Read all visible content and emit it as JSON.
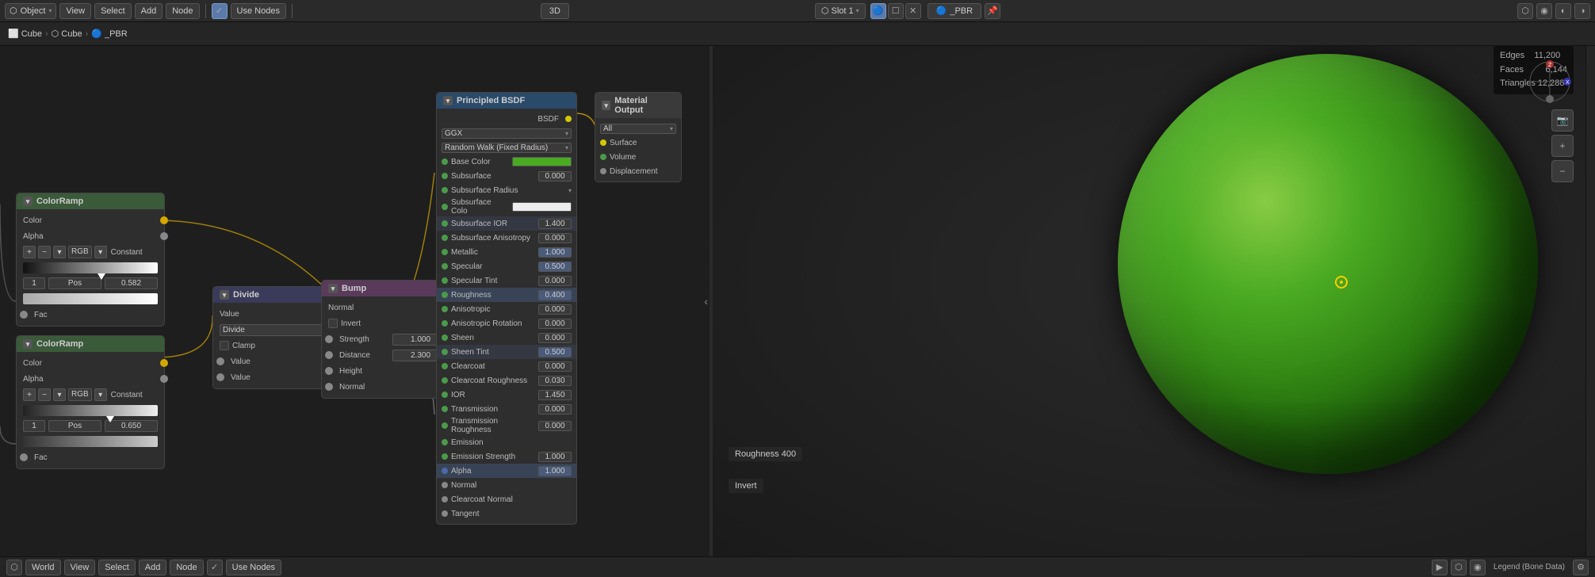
{
  "topbar": {
    "mode_label": "Object",
    "view_label": "View",
    "select_label": "Select",
    "add_label": "Add",
    "node_label": "Node",
    "use_nodes_label": "Use Nodes",
    "viewport_label": "3D",
    "slot_label": "Slot 1",
    "pbr_label": "_PBR",
    "pin_icon": "📌"
  },
  "breadcrumb": {
    "item1_icon": "⬜",
    "item1_label": "Cube",
    "item2_icon": "⬡",
    "item2_label": "Cube",
    "item3_icon": "🔵",
    "item3_label": "_PBR"
  },
  "stats": {
    "label1": "Edges",
    "value1": "11,200",
    "label2": "Faces",
    "value2": "6,144",
    "label3": "Triangles",
    "value3": "12,288"
  },
  "nodes": {
    "color_ramp_1": {
      "title": "ColorRamp",
      "color_label": "Color",
      "alpha_label": "Alpha",
      "rgb_label": "RGB",
      "constant_label": "Constant",
      "pos_num": "1",
      "pos_label": "Pos",
      "pos_value": "0.582",
      "fac_label": "Fac"
    },
    "color_ramp_2": {
      "title": "ColorRamp",
      "color_label": "Color",
      "alpha_label": "Alpha",
      "rgb_label": "RGB",
      "constant_label": "Constant",
      "pos_num": "1",
      "pos_label": "Pos",
      "pos_value": "0.650",
      "fac_label": "Fac"
    },
    "divide": {
      "title": "Divide",
      "value_label": "Value",
      "divide_label": "Divide",
      "clamp_label": "Clamp",
      "value_out1": "Value",
      "value_out2": "Value"
    },
    "bump": {
      "title": "Bump",
      "normal_label": "Normal",
      "invert_label": "Invert",
      "strength_label": "Strength",
      "strength_value": "1.000",
      "distance_label": "Distance",
      "distance_value": "2.300",
      "height_label": "Height",
      "normal_out": "Normal"
    },
    "principled": {
      "title": "Principled BSDF",
      "bsdf_label": "BSDF",
      "ggx_label": "GGX",
      "random_walk_label": "Random Walk (Fixed Radius)",
      "base_color_label": "Base Color",
      "subsurface_label": "Subsurface",
      "subsurface_value": "0.000",
      "subsurface_radius_label": "Subsurface Radius",
      "subsurface_color_label": "Subsurface Colo",
      "subsurface_ior_label": "Subsurface IOR",
      "subsurface_ior_value": "1.400",
      "subsurface_aniso_label": "Subsurface Anisotropy",
      "subsurface_aniso_value": "0.000",
      "metallic_label": "Metallic",
      "metallic_value": "1.000",
      "specular_label": "Specular",
      "specular_value": "0.500",
      "specular_tint_label": "Specular Tint",
      "specular_tint_value": "0.000",
      "roughness_label": "Roughness",
      "roughness_value": "0.400",
      "anisotropic_label": "Anisotropic",
      "anisotropic_value": "0.000",
      "aniso_rotation_label": "Anisotropic Rotation",
      "aniso_rotation_value": "0.000",
      "sheen_label": "Sheen",
      "sheen_value": "0.000",
      "sheen_tint_label": "Sheen Tint",
      "sheen_tint_value": "0.500",
      "clearcoat_label": "Clearcoat",
      "clearcoat_value": "0.000",
      "clearcoat_roughness_label": "Clearcoat Roughness",
      "clearcoat_roughness_value": "0.030",
      "ior_label": "IOR",
      "ior_value": "1.450",
      "transmission_label": "Transmission",
      "transmission_value": "0.000",
      "transmission_rough_label": "Transmission Roughness",
      "transmission_rough_value": "0.000",
      "emission_label": "Emission",
      "emission_strength_label": "Emission Strength",
      "emission_strength_value": "1.000",
      "alpha_label": "Alpha",
      "alpha_value": "1.000",
      "normal_label": "Normal",
      "clearcoat_normal_label": "Clearcoat Normal",
      "tangent_label": "Tangent"
    },
    "material_output": {
      "title": "Material Output",
      "all_label": "All",
      "surface_label": "Surface",
      "volume_label": "Volume",
      "displacement_label": "Displacement"
    }
  },
  "bottom_bar": {
    "world_label": "World",
    "view_label": "View",
    "select_label": "Select",
    "add_label": "Add",
    "node_label": "Node",
    "use_nodes_label": "Use Nodes",
    "legend_label": "Legend (Bone Data)"
  }
}
